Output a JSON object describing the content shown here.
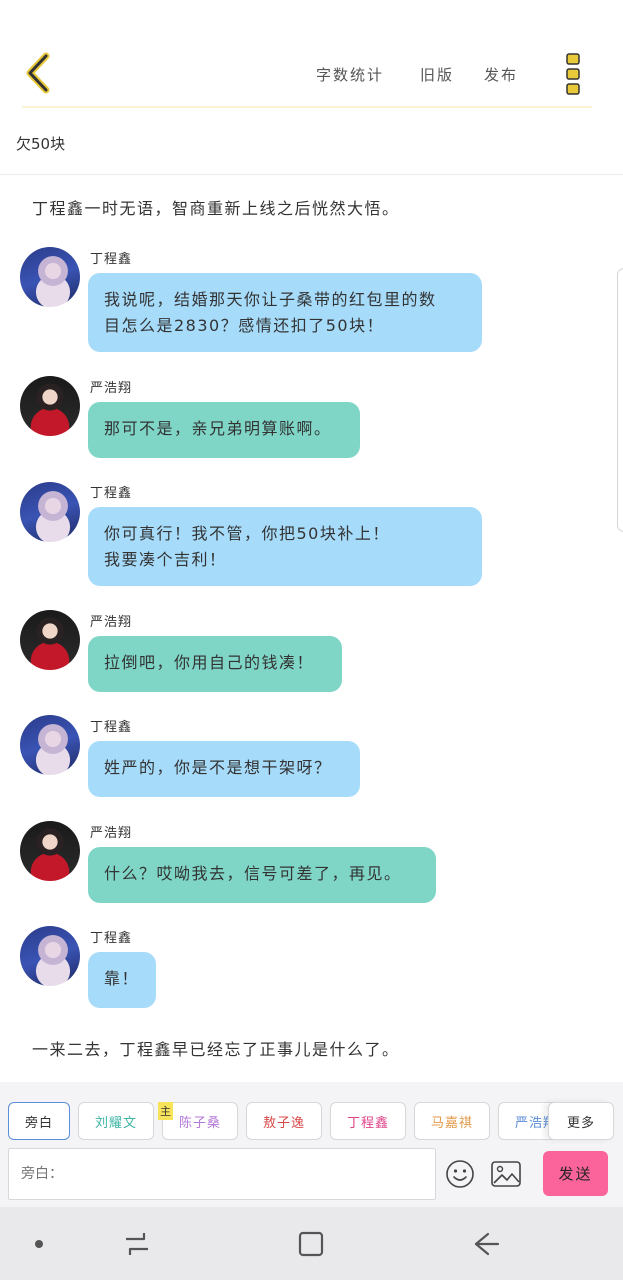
{
  "header": {
    "word_count_label": "字数统计",
    "old_version_label": "旧版",
    "publish_label": "发布"
  },
  "title": "欠50块",
  "chat": {
    "narration_top": "丁程鑫一时无语，智商重新上线之后恍然大悟。",
    "narration_bottom": "一来二去，丁程鑫早已经忘了正事儿是什么了。",
    "messages": [
      {
        "speaker": "丁程鑫",
        "line1": "我说呢，结婚那天你让子桑带的红包里的数",
        "line2": "目怎么是2830？感情还扣了50块！"
      },
      {
        "speaker": "严浩翔",
        "line1": "那可不是，亲兄弟明算账啊。"
      },
      {
        "speaker": "丁程鑫",
        "line1": "你可真行！我不管，你把50块补上！",
        "line2": "我要凑个吉利！"
      },
      {
        "speaker": "严浩翔",
        "line1": "拉倒吧，你用自己的钱凑！"
      },
      {
        "speaker": "丁程鑫",
        "line1": "姓严的，你是不是想干架呀？"
      },
      {
        "speaker": "严浩翔",
        "line1": "什么？哎呦我去，信号可差了，再见。"
      },
      {
        "speaker": "丁程鑫",
        "line1": "靠！"
      }
    ]
  },
  "composer": {
    "roles": [
      "旁白",
      "刘耀文",
      "陈子桑",
      "敖子逸",
      "丁程鑫",
      "马嘉祺",
      "严浩翔"
    ],
    "host_tag": "主",
    "more_label": "更多",
    "input_placeholder": "旁白：",
    "send_label": "发送"
  },
  "colors": {
    "bubble_blue": "#a6dbfa",
    "bubble_green": "#7fd6c7",
    "send": "#fa649a",
    "accent_yellow": "#e8c93a"
  }
}
